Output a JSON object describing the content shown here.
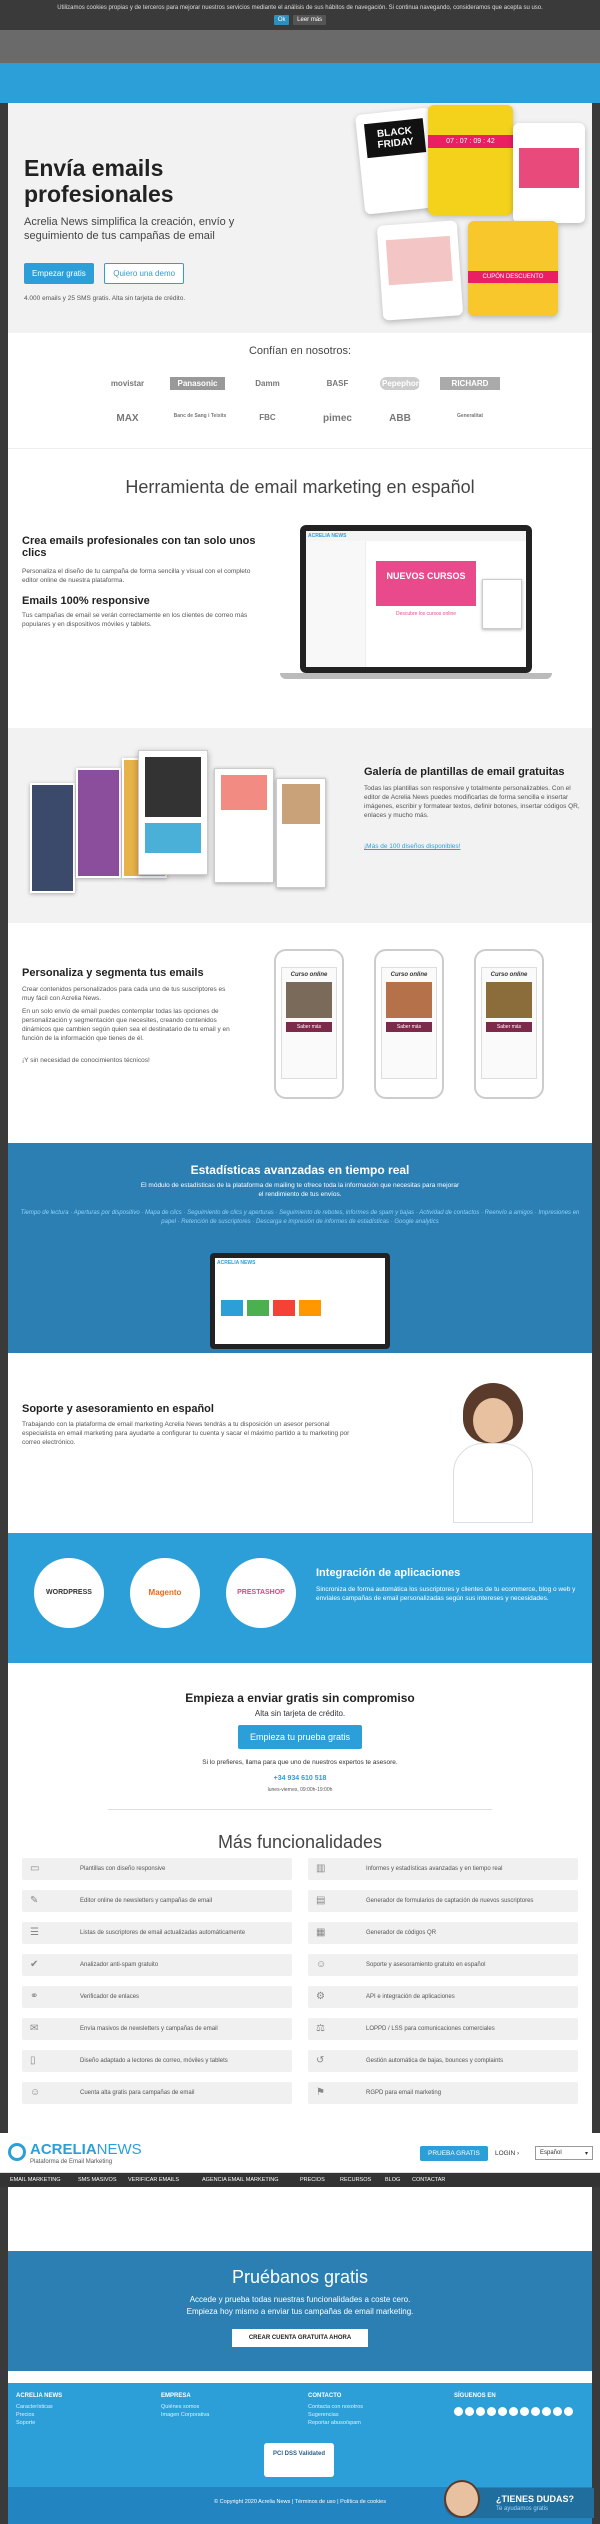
{
  "cookie": {
    "text": "Utilizamos cookies propias y de terceros para mejorar nuestros servicios mediante el análisis de sus hábitos de navegación. Si continua navegando, consideramos que acepta su uso.",
    "ok": "Ok",
    "more": "Leer más"
  },
  "hero": {
    "title": "Envía emails profesionales",
    "subtitle": "Acrelia News simplifica la creación, envío y seguimiento de tus campañas de email",
    "cta_primary": "Empezar gratis",
    "cta_secondary": "Quiero una demo",
    "note": "4.000 emails y 25 SMS gratis. Alta sin tarjeta de crédito.",
    "card_texts": [
      "BLACK FRIDAY",
      "07 : 07 : 09 : 42",
      "CUPÓN DESCUENTO"
    ]
  },
  "trust": {
    "title": "Confían en nosotros:",
    "logos": [
      "movistar",
      "Panasonic",
      "Damm",
      "BASF",
      "Pepephone",
      "RICHARD",
      "MAX",
      "Banc de Sang i Teixits",
      "FBC",
      "pimec",
      "ABB",
      "Generalitat"
    ]
  },
  "tool": {
    "title": "Herramienta de email marketing en español",
    "h_create": "Crea emails profesionales con tan solo unos clics",
    "p_create": "Personaliza el diseño de tu campaña de forma sencilla y visual con el completo editor online de nuestra plataforma.",
    "h_responsive": "Emails 100% responsive",
    "p_responsive": "Tus campañas de email se verán correctamente en los clientes de correo más populares y en dispositivos móviles y tablets.",
    "laptop_banner": "NUEVOS CURSOS",
    "laptop_sub": "Descubre los cursos online",
    "laptop_brand": "ACRELIA NEWS"
  },
  "gallery": {
    "title": "Galería de plantillas de email gratuitas",
    "text": "Todas las plantillas son responsive y totalmente personalizables. Con el editor de Acrelia News puedes modificarlas de forma sencilla e insertar imágenes, escribir y formatear textos, definir botones, insertar códigos QR, enlaces y mucho más.",
    "link": "¡Más de 100 diseños disponibles!"
  },
  "personalize": {
    "title": "Personaliza y segmenta tus emails",
    "p1": "Crear contenidos personalizados para cada uno de tus suscriptores es muy fácil con Acrelia News.",
    "p2": "En un solo envío de email puedes contemplar todas las opciones de personalización y segmentación que necesites, creando contenidos dinámicos que cambien según quien sea el destinatario de tu email y en función de la información que tienes de él.",
    "p3": "¡Y sin necesidad de conocimientos técnicos!",
    "phone_title": "Curso online",
    "phone_btn": "Saber más"
  },
  "stats": {
    "title": "Estadísticas avanzadas en tiempo real",
    "text": "El módulo de estadísticas de la plataforma de mailing te ofrece toda la información que necesitas para mejorar el rendimiento de tus envíos.",
    "features": "Tiempo de lectura · Aperturas por dispositivo · Mapa de clics · Seguimiento de clics y aperturas · Seguimiento de rebotes, informes de spam y bajas · Actividad de contactos · Reenvío a amigos · Impresiones en papel · Retención de suscriptores · Descarga e impresión de informes de estadísticas · Google analytics",
    "laptop_brand": "ACRELIA NEWS"
  },
  "support": {
    "title": "Soporte y asesoramiento en español",
    "text": "Trabajando con la plataforma de email marketing Acrelia News tendrás a tu disposición un asesor personal especialista en email marketing para ayudarte a configurar tu cuenta y sacar el máximo partido a tu marketing por correo electrónico."
  },
  "integrations": {
    "title": "Integración de aplicaciones",
    "text": "Sincroniza de forma automática los suscriptores y clientes de tu ecommerce, blog o web y envíales campañas de email personalizadas según sus intereses y necesidades.",
    "logos": [
      "WORDPRESS",
      "Magento",
      "PRESTASHOP"
    ]
  },
  "signup": {
    "title": "Empieza a enviar gratis sin compromiso",
    "subtitle": "Alta sin tarjeta de crédito.",
    "cta": "Empieza tu prueba gratis",
    "call": "Si lo prefieres, llama para que uno de nuestros expertos te asesore.",
    "phone": "+34 934 610 518",
    "hours": "lunes-viernes, 09:00h-19:00h"
  },
  "more": {
    "title": "Más funcionalidades",
    "left": [
      "Plantillas con diseño responsive",
      "Editor online de newsletters y campañas de email",
      "Listas de suscriptores de email actualizadas automáticamente",
      "Analizador anti-spam gratuito",
      "Verificador de enlaces",
      "Envía masivos de newsletters y campañas de email",
      "Diseño adaptado a lectores de correo, móviles y tablets",
      "Cuenta alta gratis para campañas de email"
    ],
    "right": [
      "Informes y estadísticas avanzadas y en tiempo real",
      "Generador de formularios de captación de nuevos suscriptores",
      "Generador de códigos QR",
      "Soporte y asesoramiento gratuito en español",
      "API e integración de aplicaciones",
      "LOPPD / LSS para comunicaciones comerciales",
      "Gestión automática de bajas, bounces y complaints",
      "RGPD para email marketing"
    ],
    "icons_left": [
      "responsive-icon",
      "editor-icon",
      "list-icon",
      "antispam-icon",
      "link-check-icon",
      "send-icon",
      "devices-icon",
      "account-icon"
    ],
    "icons_right": [
      "stats-icon",
      "form-icon",
      "qr-icon",
      "support-icon",
      "api-icon",
      "lopd-icon",
      "bounce-icon",
      "rgpd-icon"
    ]
  },
  "sticky": {
    "brand": "ACRELIA",
    "brand2": "NEWS",
    "tagline": "Plataforma de Email Marketing",
    "cta": "PRUEBA GRATIS",
    "login": "LOGIN",
    "lang": "Español",
    "nav": [
      "EMAIL MARKETING",
      "SMS MASIVOS",
      "VERIFICAR EMAILS",
      "AGENCIA EMAIL MARKETING",
      "PRECIOS",
      "RECURSOS",
      "BLOG",
      "CONTACTAR"
    ]
  },
  "try": {
    "title": "Pruébanos gratis",
    "text1": "Accede y prueba todas nuestras funcionalidades a coste cero.",
    "text2": "Empieza hoy mismo a enviar tus campañas de email marketing.",
    "cta": "CREAR CUENTA GRATUITA AHORA"
  },
  "footer": {
    "col1_title": "ACRELIA NEWS",
    "col1": [
      "Características",
      "Precios",
      "Soporte"
    ],
    "col2_title": "EMPRESA",
    "col2": [
      "Quiénes somos",
      "Imagen Corporativa"
    ],
    "col3_title": "CONTACTO",
    "col3": [
      "Contacta con nosotros",
      "Sugerencias",
      "Reportar abuso/spam"
    ],
    "col4_title": "SÍGUENOS EN",
    "pci": "PCI DSS Validated",
    "copyright": "© Copyright 2020 Acrelia News | Términos de uso | Política de cookies",
    "chat_title": "¿TIENES DUDAS?",
    "chat_sub": "Te ayudamos gratis"
  },
  "colors": {
    "accent": "#2c9fd9",
    "dark": "#3a3a3a",
    "blue_section": "#2b7fb3"
  }
}
